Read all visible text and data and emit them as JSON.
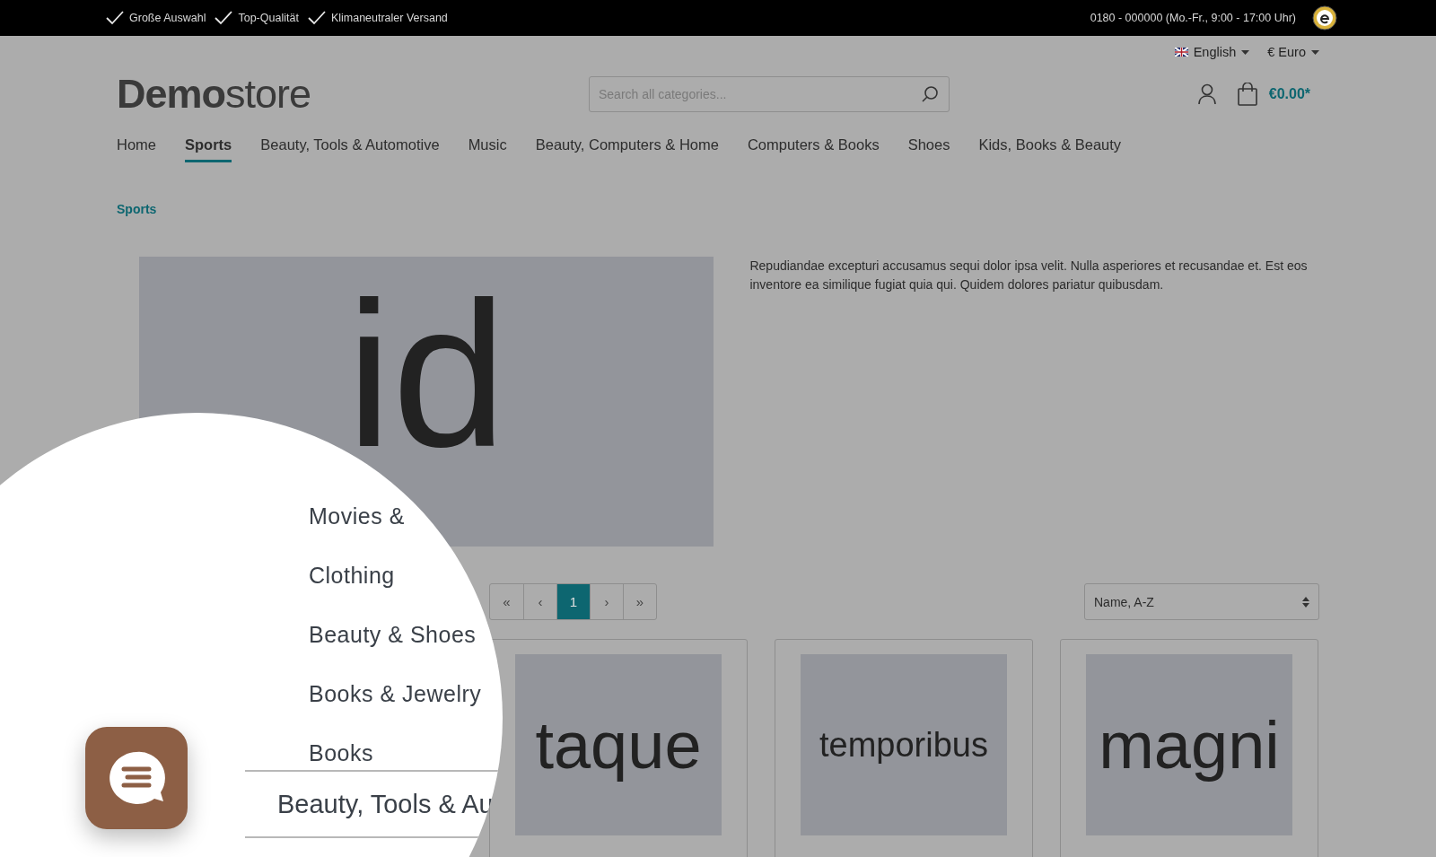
{
  "top_bar": {
    "usps": [
      "Große Auswahl",
      "Top-Qualität",
      "Klimaneutraler Versand"
    ],
    "hotline": "0180 - 000000 (Mo.-Fr., 9:00 - 17:00 Uhr)"
  },
  "header": {
    "language": "English",
    "currency": "€ Euro",
    "logo": {
      "bold": "Demo",
      "light": "store"
    },
    "search": {
      "placeholder": "Search all categories..."
    },
    "cart_total": "€0.00*"
  },
  "nav": [
    {
      "label": "Home",
      "selected": false
    },
    {
      "label": "Sports",
      "selected": true
    },
    {
      "label": "Beauty, Tools & Automotive",
      "selected": false
    },
    {
      "label": "Music",
      "selected": false
    },
    {
      "label": "Beauty, Computers & Home",
      "selected": false
    },
    {
      "label": "Computers & Books",
      "selected": false
    },
    {
      "label": "Shoes",
      "selected": false
    },
    {
      "label": "Kids, Books & Beauty",
      "selected": false
    }
  ],
  "breadcrumb": "Sports",
  "category": {
    "image_text": "id",
    "description": "Repudiandae excepturi accusamus sequi dolor ipsa velit. Nulla asperiores et recusandae et. Est eos inventore ea similique fugiat quia qui. Quidem dolores pariatur quibusdam."
  },
  "pagination": [
    {
      "label": "«",
      "selected": false
    },
    {
      "label": "‹",
      "selected": false
    },
    {
      "label": "1",
      "selected": true
    },
    {
      "label": "›",
      "selected": false
    },
    {
      "label": "»",
      "selected": false
    }
  ],
  "sort": "Name, A-Z",
  "products": [
    {
      "image_text": "taque"
    },
    {
      "image_text": "temporibus"
    },
    {
      "image_text": "magni"
    }
  ],
  "magnifier": {
    "items": [
      "Movies &",
      "Clothing",
      "Beauty & Shoes",
      "Books & Jewelry",
      "Books"
    ],
    "parent": "Beauty, Tools & Au"
  }
}
